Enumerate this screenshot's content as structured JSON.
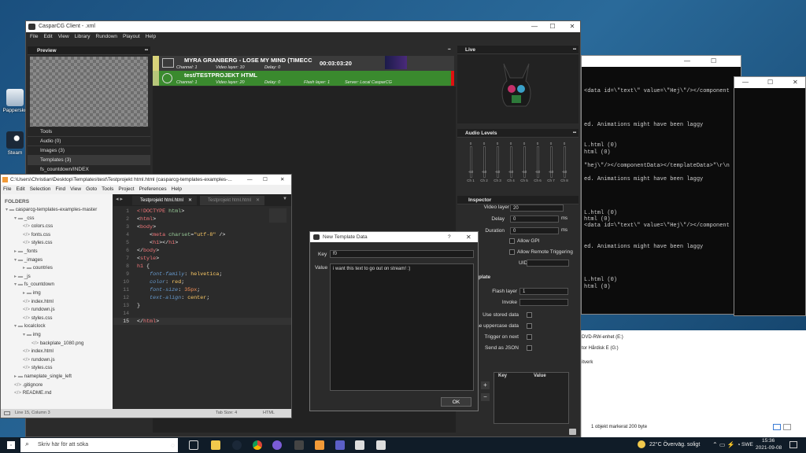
{
  "desktop": {
    "icons": [
      {
        "label": "Pappersko"
      },
      {
        "label": "Steam"
      }
    ]
  },
  "console": {
    "lines": [
      "<data id=\\\"text\\\" value=\\\"Hej\\\"/></component",
      "ed. Animations might have been laggy",
      "L.html (0)",
      "html (0)",
      "\"hej\\\"/></componentData></templateData>\"\\r\\n",
      "ed. Animations might have been laggy",
      "L.html (0)",
      "html (0)",
      "<data id=\\\"text\\\" value=\\\"Hej\\\"/></component",
      "ed. Animations might have been laggy",
      "L.html (0)",
      "html (0)"
    ]
  },
  "explorer": {
    "drive1": "DVD-RW-enhet (E:)",
    "drive2": "tor Hårdisk E (G:)",
    "network": "itverk",
    "status": "1 objekt markerat  200 byte"
  },
  "caspar": {
    "title": "CasparCG Client - .xml",
    "menu": [
      "File",
      "Edit",
      "View",
      "Library",
      "Rundown",
      "Playout",
      "Help"
    ],
    "preview": {
      "title": "Preview"
    },
    "live": {
      "title": "Live"
    },
    "library": {
      "tools": "Tools",
      "audio": "Audio (0)",
      "images": "Images (3)",
      "templates": "Templates (3)",
      "folders": "fs_countdown/INDEX"
    },
    "rundown": [
      {
        "name": "MYRA GRANBERG - LOSE MY MIND (TIMECC",
        "time": "00:03:03:20",
        "channel": "Channel: 1",
        "layer": "Video layer: 10",
        "delay": "Delay: 0"
      },
      {
        "name": "test/TESTPROJEKT HTML",
        "channel": "Channel: 1",
        "layer": "Video layer: 20",
        "delay": "Delay: 0",
        "flash": "Flash layer: 1",
        "server": "Server: Local CasparCG"
      }
    ],
    "audio": {
      "title": "Audio Levels",
      "top": [
        "0",
        "0",
        "0",
        "0",
        "0",
        "0",
        "0",
        "0"
      ],
      "mid": "-60",
      "bottom": [
        "-60",
        "-60",
        "-60",
        "-60",
        "-60",
        "-60",
        "-60",
        "-60"
      ],
      "channels": [
        "Ch 1",
        "Ch 2",
        "Ch 3",
        "Ch 4",
        "Ch 5",
        "Ch 6",
        "Ch 7",
        "Ch 8"
      ]
    },
    "inspector": {
      "title": "Inspector",
      "video_layer_label": "Video layer",
      "video_layer": "20",
      "delay_label": "Delay",
      "delay": "0",
      "duration_label": "Duration",
      "duration": "0",
      "ms": "ms",
      "allow_gpi": "Allow GPI",
      "allow_remote": "Allow Remote Triggering",
      "uid": "UID",
      "section": "plate",
      "flash_label": "Flash layer",
      "flash": "1",
      "invoke": "Invoke",
      "use_stored": "Use stored data",
      "use_upper": "Use uppercase data",
      "trigger_next": "Trigger on next",
      "send_json": "Send as JSON",
      "key_col": "Key",
      "value_col": "Value",
      "add": "+",
      "remove": "−"
    }
  },
  "sublime": {
    "title": "C:\\Users\\Christian\\Desktop\\Templates\\test\\Testprojekt html.html (casparcg-templates-examples-...",
    "menu": [
      "File",
      "Edit",
      "Selection",
      "Find",
      "View",
      "Goto",
      "Tools",
      "Project",
      "Preferences",
      "Help"
    ],
    "folders_title": "FOLDERS",
    "tree": [
      {
        "t": "casparcg-templates-examples-master",
        "d": 0,
        "o": true
      },
      {
        "t": "_css",
        "d": 1,
        "o": true
      },
      {
        "t": "colors.css",
        "d": 2,
        "f": true
      },
      {
        "t": "fonts.css",
        "d": 2,
        "f": true
      },
      {
        "t": "styles.css",
        "d": 2,
        "f": true
      },
      {
        "t": "_fonts",
        "d": 1
      },
      {
        "t": "_images",
        "d": 1,
        "o": true
      },
      {
        "t": "countries",
        "d": 2
      },
      {
        "t": "_js",
        "d": 1
      },
      {
        "t": "fs_countdown",
        "d": 1,
        "o": true
      },
      {
        "t": "img",
        "d": 2
      },
      {
        "t": "index.html",
        "d": 2,
        "f": true
      },
      {
        "t": "rundown.js",
        "d": 2,
        "f": true
      },
      {
        "t": "styles.css",
        "d": 2,
        "f": true
      },
      {
        "t": "localclock",
        "d": 1,
        "o": true
      },
      {
        "t": "img",
        "d": 2,
        "o": true
      },
      {
        "t": "backplate_1080.png",
        "d": 3,
        "f": true
      },
      {
        "t": "index.html",
        "d": 2,
        "f": true
      },
      {
        "t": "rundown.js",
        "d": 2,
        "f": true
      },
      {
        "t": "styles.css",
        "d": 2,
        "f": true
      },
      {
        "t": "nameplate_single_left",
        "d": 1
      },
      {
        "t": ".gitignore",
        "d": 1,
        "f": true
      },
      {
        "t": "README.md",
        "d": 1,
        "f": true
      }
    ],
    "tabs": [
      "Testprojekt html.html",
      "Testprojekt html.html"
    ],
    "status_left": "Line 15, Column 3",
    "status_tab": "Tab Size: 4",
    "status_syntax": "HTML"
  },
  "dialog": {
    "title": "New Template Data",
    "help": "?",
    "key_label": "Key",
    "key": "f0",
    "value_label": "Value",
    "value": "i want this text to go out on stream! :)",
    "ok": "OK"
  },
  "taskbar": {
    "search": "Skriv här för att söka",
    "weather": "22°C  Överväg. soligt",
    "lang": "SWE",
    "time": "15:36",
    "date": "2021-09-08"
  }
}
